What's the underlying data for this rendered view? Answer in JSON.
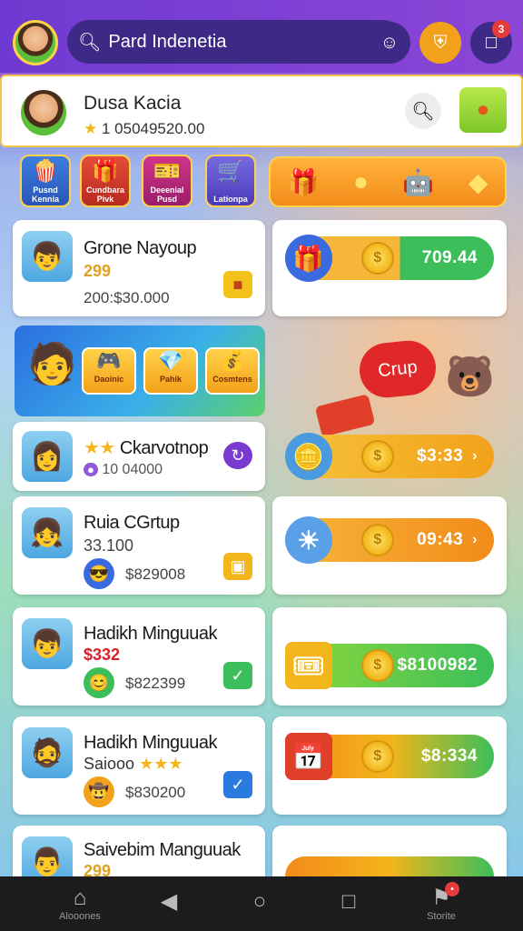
{
  "topbar": {
    "search_text": "Pard Indenetia",
    "notification_count": "3"
  },
  "profile": {
    "name": "Dusa Kacia",
    "coins": "1 05049520.00"
  },
  "categories": [
    {
      "label": "Pusnd Kennia",
      "icon": "popcorn-icon"
    },
    {
      "label": "Cundbara Pivk",
      "icon": "gift-icon"
    },
    {
      "label": "Deeenial Pusd",
      "icon": "ticket-icon"
    },
    {
      "label": "Lationpa",
      "icon": "cart-icon"
    }
  ],
  "players": [
    {
      "name": "Grone Nayoup",
      "sub": "299",
      "amount": "200:$30.000",
      "action": "bag-icon"
    },
    {
      "name": "Ckarvotnop",
      "sub": "10 04000",
      "amount": "",
      "action": "refresh-icon"
    },
    {
      "name": "Ruia CGrtup",
      "sub": "33.100",
      "amount": "$829008",
      "action": "box-icon"
    },
    {
      "name": "Hadikh Minguuak",
      "sub": "$332",
      "amount": "$822399",
      "action": "check-icon"
    },
    {
      "name": "Hadikh Minguuak",
      "sub": "Saiooo",
      "amount": "$830200",
      "action": "check-icon"
    },
    {
      "name": "Saivebim Manguuak",
      "sub": "299",
      "amount": "",
      "action": ""
    }
  ],
  "rewards": [
    {
      "value": "709.44"
    },
    {
      "value": "$3:33"
    },
    {
      "value": "09:43"
    },
    {
      "value": "$8100982"
    },
    {
      "value": "$8:334"
    }
  ],
  "banner": {
    "tiles": [
      "Daoinic",
      "Pahik",
      "Cosmtens"
    ]
  },
  "promo": {
    "heart_label": "Crup"
  },
  "navbar": {
    "home_label": "Alooones",
    "store_label": "Storite"
  },
  "colors": {
    "topbar": "#6f3ad1",
    "green_pill": "#5cc83a",
    "orange_pill": "#f5901e",
    "yellow_pill": "#f6c23a"
  }
}
